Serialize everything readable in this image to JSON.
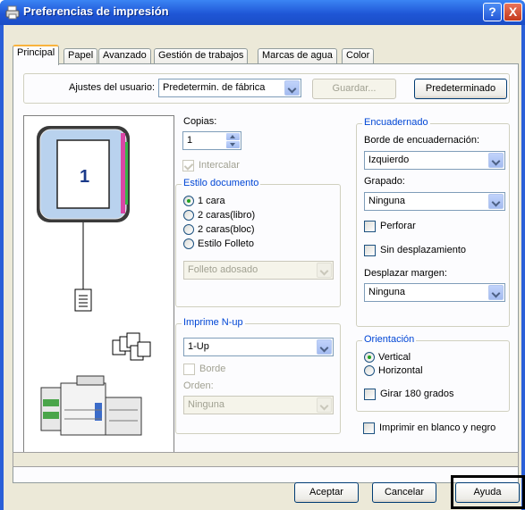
{
  "window": {
    "title": "Preferencias de impresión",
    "help_button": "?",
    "close_button": "X"
  },
  "tabs": [
    "Principal",
    "Papel",
    "Avanzado",
    "Gestión de trabajos",
    "Marcas de agua",
    "Color"
  ],
  "active_tab": "Principal",
  "user_settings": {
    "label": "Ajustes del usuario:",
    "value": "Predetermin. de fábrica",
    "save_button": "Guardar...",
    "default_button": "Predeterminado"
  },
  "preview": {
    "page_number": "1"
  },
  "copies": {
    "label": "Copias:",
    "value": "1",
    "collate_label": "Intercalar",
    "collate_checked": true
  },
  "document_style": {
    "title": "Estilo documento",
    "options": [
      "1 cara",
      "2 caras(libro)",
      "2 caras(bloc)",
      "Estilo Folleto"
    ],
    "selected": "1 cara",
    "booklet_value": "Folleto adosado"
  },
  "nup": {
    "title": "Imprime N-up",
    "value": "1-Up",
    "border_label": "Borde",
    "order_label": "Orden:",
    "order_value": "Ninguna"
  },
  "binding": {
    "title": "Encuadernado",
    "edge_label": "Borde de encuadernación:",
    "edge_value": "Izquierdo",
    "staple_label": "Grapado:",
    "staple_value": "Ninguna",
    "punch_label": "Perforar",
    "no_offset_label": "Sin desplazamiento",
    "margin_label": "Desplazar margen:",
    "margin_value": "Ninguna"
  },
  "orientation": {
    "title": "Orientación",
    "options": [
      "Vertical",
      "Horizontal"
    ],
    "selected": "Vertical",
    "rotate_label": "Girar 180 grados"
  },
  "bw_label": "Imprimir en blanco y negro",
  "footer": {
    "ok": "Aceptar",
    "cancel": "Cancelar",
    "help": "Ayuda"
  }
}
